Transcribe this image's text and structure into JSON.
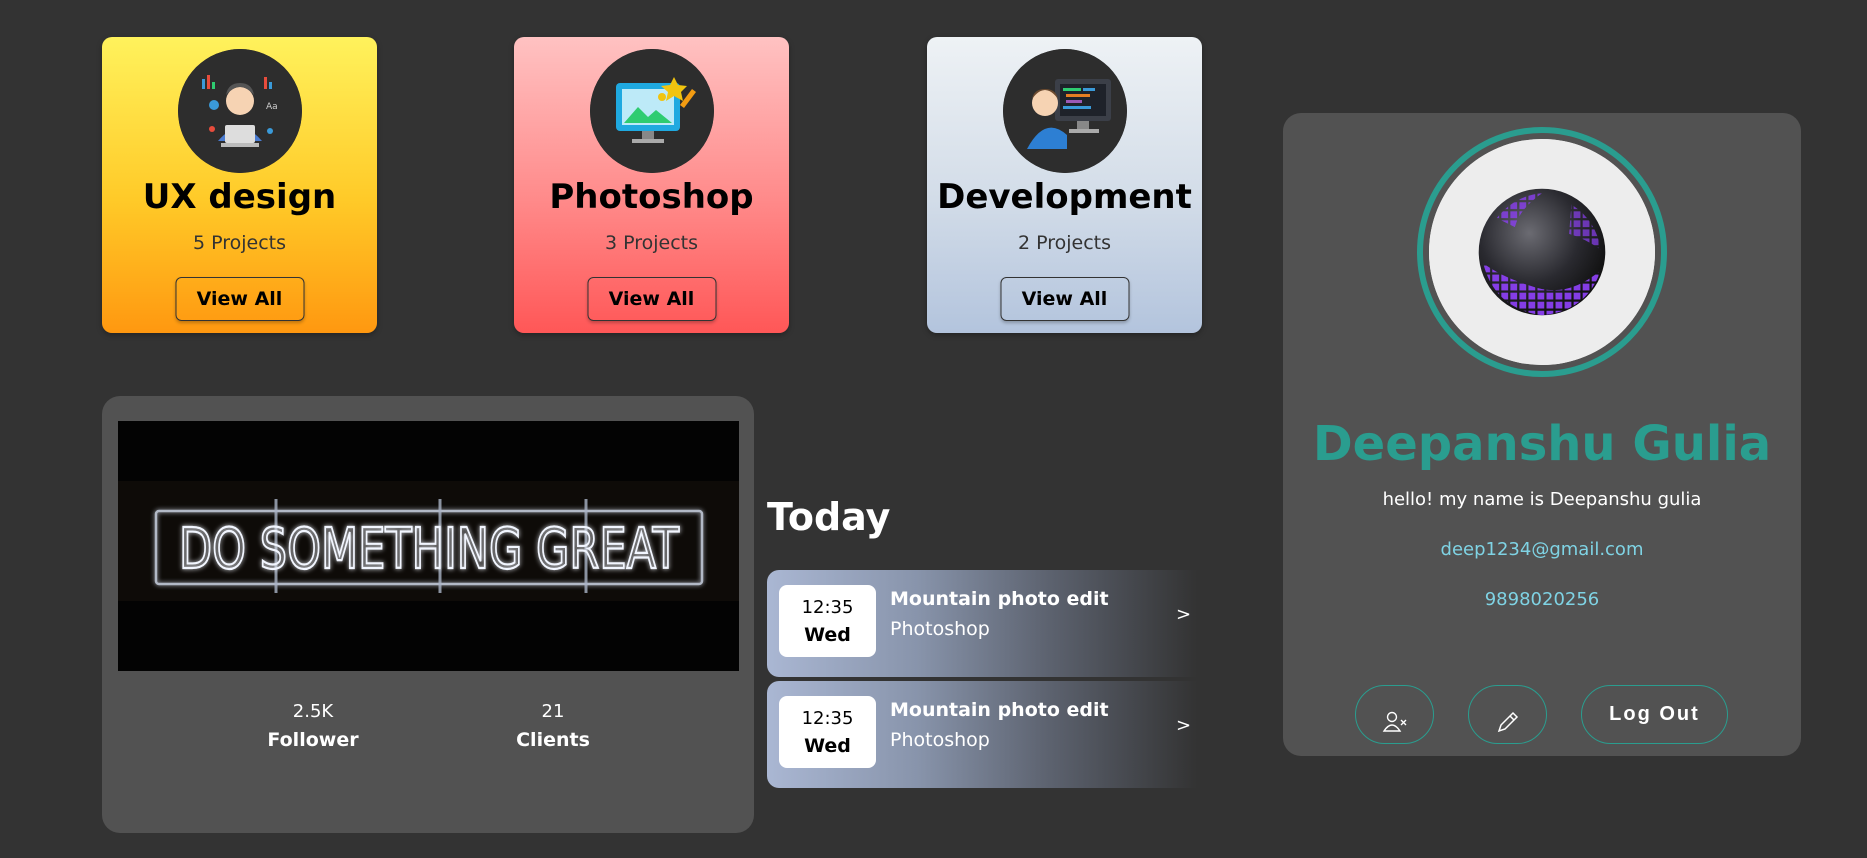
{
  "categories": [
    {
      "title": "UX design",
      "subtitle": "5 Projects",
      "button": "View All",
      "icon": "ux-designer-icon"
    },
    {
      "title": "Photoshop",
      "subtitle": "3 Projects",
      "button": "View All",
      "icon": "photo-editor-icon"
    },
    {
      "title": "Development",
      "subtitle": "2 Projects",
      "button": "View All",
      "icon": "developer-icon"
    }
  ],
  "banner": {
    "neon_text": "DO SOMETHING GREAT",
    "stats": [
      {
        "value": "2.5K",
        "label": "Follower"
      },
      {
        "value": "21",
        "label": "Clients"
      }
    ]
  },
  "today": {
    "title": "Today",
    "tasks": [
      {
        "time": "12:35",
        "day": "Wed",
        "name": "Mountain photo edit",
        "app": "Photoshop",
        "chevron": ">"
      },
      {
        "time": "12:35",
        "day": "Wed",
        "name": "Mountain photo edit",
        "app": "Photoshop",
        "chevron": ">"
      }
    ]
  },
  "profile": {
    "name": "Deepanshu Gulia",
    "bio": "hello! my name is Deepanshu gulia",
    "email": "deep1234@gmail.com",
    "phone": "9898020256",
    "actions": {
      "unfollow_icon": "user-remove-icon",
      "edit_icon": "pencil-icon",
      "logout_label": "Log Out"
    }
  },
  "colors": {
    "background": "#333333",
    "panel": "#525252",
    "accent": "#2a9d8f",
    "link": "#7fd3e4"
  }
}
